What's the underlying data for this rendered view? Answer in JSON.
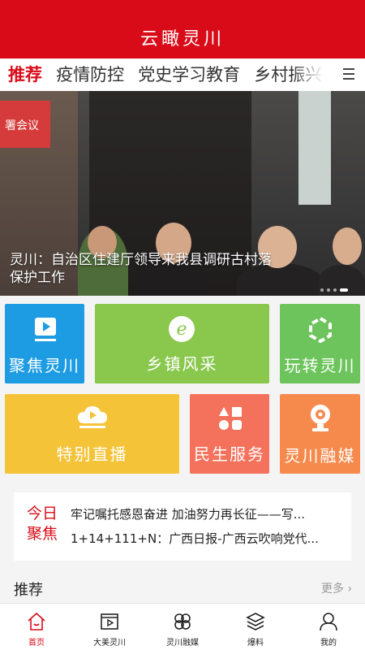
{
  "app": {
    "title": "云瞰灵川"
  },
  "tabs": [
    {
      "label": "推荐",
      "active": true
    },
    {
      "label": "疫情防控"
    },
    {
      "label": "党史学习教育"
    },
    {
      "label": "乡村振兴"
    }
  ],
  "tabs_menu_icon": "menu-icon",
  "banner": {
    "sign_text": "署会议",
    "caption": "灵川：自治区住建厅领导来我县调研古村落保护工作",
    "slide_count": 4,
    "active_slide": 4
  },
  "tiles": [
    {
      "label": "聚焦灵川",
      "color": "#1e9ce3",
      "icon": "play-icon"
    },
    {
      "label": "乡镇风采",
      "color": "#89c74d",
      "icon": "e-icon"
    },
    {
      "label": "玩转灵川",
      "color": "#6dc45c",
      "icon": "hexagon-icon"
    },
    {
      "label": "特别直播",
      "color": "#f5c338",
      "icon": "cloud-play-icon"
    },
    {
      "label": "民生服务",
      "color": "#f4715c",
      "icon": "shapes-icon"
    },
    {
      "label": "灵川融媒",
      "color": "#f68a4d",
      "icon": "camera-icon"
    }
  ],
  "today": {
    "tag": "今日聚焦",
    "headlines": [
      "牢记嘱托感恩奋进 加油努力再长征——写...",
      "1+14+111+N：广西日报-广西云吹响党代..."
    ]
  },
  "section": {
    "title": "推荐",
    "more": "更多"
  },
  "bottom_nav": [
    {
      "label": "首页",
      "icon": "home-icon",
      "active": true
    },
    {
      "label": "大美灵川",
      "icon": "video-icon"
    },
    {
      "label": "灵川融媒",
      "icon": "clover-icon"
    },
    {
      "label": "爆料",
      "icon": "layers-icon"
    },
    {
      "label": "我的",
      "icon": "user-icon"
    }
  ],
  "colors": {
    "brand": "#d90b18",
    "tab_active": "#d90b18"
  }
}
